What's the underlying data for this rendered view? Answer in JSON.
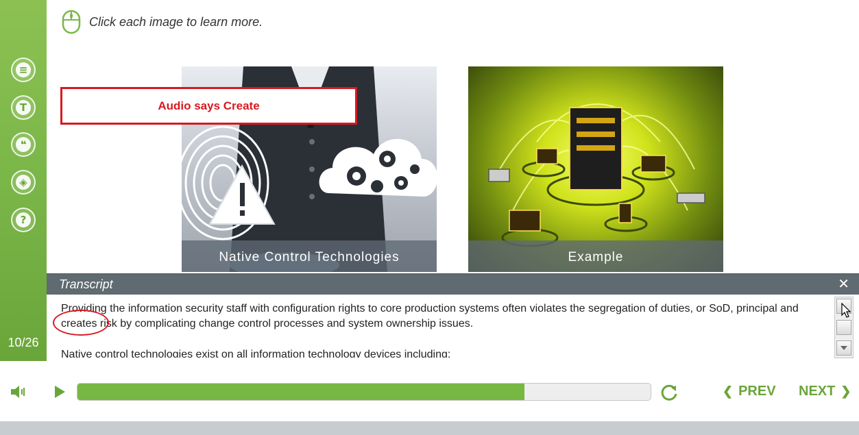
{
  "sidebar": {
    "counter": "10/26",
    "buttons": [
      {
        "name": "menu-list-icon",
        "glyph": "≡"
      },
      {
        "name": "text-icon",
        "glyph": "T"
      },
      {
        "name": "quote-icon",
        "glyph": "❝"
      },
      {
        "name": "layers-icon",
        "glyph": "◈"
      },
      {
        "name": "help-icon",
        "glyph": "?"
      }
    ]
  },
  "instruction": {
    "text": "Click each image to learn more.",
    "icon": "mouse-icon"
  },
  "cards": [
    {
      "caption": "Native Control Technologies"
    },
    {
      "caption": "Example"
    }
  ],
  "annotation": {
    "text": "Audio says Create",
    "color": "#d71920"
  },
  "transcript": {
    "title": "Transcript",
    "close_icon": "✕",
    "paragraphs": [
      "Providing the information security staff with configuration rights to core production systems often violates the segregation of duties, or SoD, principal and creates risk by complicating change control processes and system ownership issues.",
      "Native control technologies exist on all information technology devices including:"
    ]
  },
  "player": {
    "progress": 0.78,
    "prev_label": "PREV",
    "next_label": "NEXT",
    "accent": "#6aa53a"
  }
}
